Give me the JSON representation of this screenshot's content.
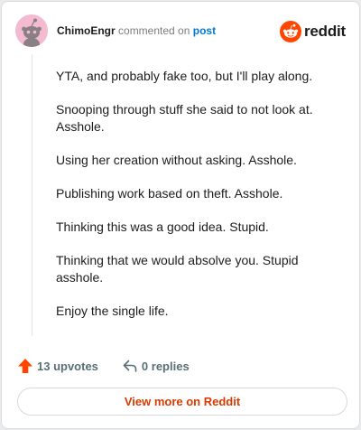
{
  "header": {
    "author": "ChimoEngr",
    "commented_on": "commented on",
    "post_link": "post",
    "brand": "reddit"
  },
  "comment": {
    "paragraphs": [
      "YTA, and probably fake too, but I'll play along.",
      "Snooping through stuff she said to not look at. Asshole.",
      "Using her creation without asking. Asshole.",
      "Publishing work based on theft. Asshole.",
      "Thinking this was a good idea. Stupid.",
      "Thinking that we would absolve you. Stupid asshole.",
      "Enjoy the single life."
    ]
  },
  "actions": {
    "upvotes": "13 upvotes",
    "replies": "0 replies"
  },
  "footer": {
    "view_more": "View more on Reddit"
  },
  "colors": {
    "brand_orange": "#ff4500",
    "upvote_orange": "#ff4500",
    "link_blue": "#0079d3",
    "view_more_text": "#d93a00",
    "avatar_bg": "#f4bbd0"
  },
  "icons": {
    "avatar": "snoo-avatar-icon",
    "brand": "reddit-logo-icon",
    "upvote": "upvote-arrow-icon",
    "reply": "reply-arrow-icon"
  }
}
